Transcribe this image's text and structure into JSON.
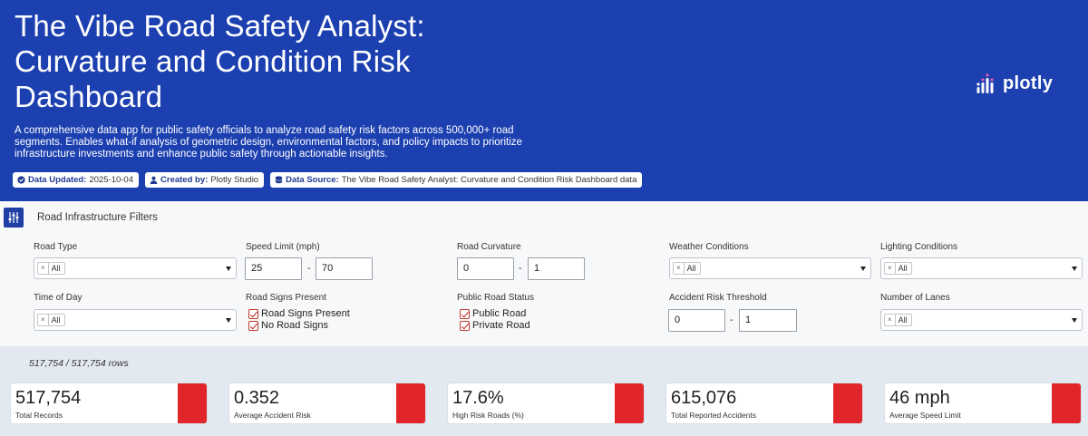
{
  "header": {
    "title": "The Vibe Road Safety Analyst: Curvature and Condition Risk Dashboard",
    "description": "A comprehensive data app for public safety officials to analyze road safety risk factors across 500,000+ road segments. Enables what-if analysis of geometric design, environmental factors, and policy impacts to prioritize infrastructure investments and enhance public safety through actionable insights.",
    "badges": [
      {
        "label": "Data Updated:",
        "value": "2025-10-04",
        "icon": "check-circle-icon"
      },
      {
        "label": "Created by:",
        "value": "Plotly Studio",
        "icon": "user-icon"
      },
      {
        "label": "Data Source:",
        "value": "The Vibe Road Safety Analyst: Curvature and Condition Risk Dashboard data",
        "icon": "database-icon"
      }
    ],
    "logo_text": "plotly"
  },
  "filters": {
    "heading": "Road Infrastructure Filters",
    "road_type": {
      "label": "Road Type",
      "value": "All"
    },
    "speed_limit": {
      "label": "Speed Limit (mph)",
      "min": "25",
      "max": "70"
    },
    "road_curvature": {
      "label": "Road Curvature",
      "min": "0",
      "max": "1"
    },
    "weather": {
      "label": "Weather Conditions",
      "value": "All"
    },
    "lighting": {
      "label": "Lighting Conditions",
      "value": "All"
    },
    "time_of_day": {
      "label": "Time of Day",
      "value": "All"
    },
    "road_signs": {
      "label": "Road Signs Present",
      "options": [
        "Road Signs Present",
        "No Road Signs"
      ]
    },
    "public_road": {
      "label": "Public Road Status",
      "options": [
        "Public Road",
        "Private Road"
      ]
    },
    "risk_threshold": {
      "label": "Accident Risk Threshold",
      "min": "0",
      "max": "1"
    },
    "lanes": {
      "label": "Number of Lanes",
      "value": "All"
    },
    "chip_remove": "×",
    "range_sep": "-"
  },
  "row_count": "517,754 / 517,754 rows",
  "kpis": [
    {
      "value": "517,754",
      "label": "Total Records"
    },
    {
      "value": "0.352",
      "label": "Average Accident Risk"
    },
    {
      "value": "17.6%",
      "label": "High Risk Roads (%)"
    },
    {
      "value": "615,076",
      "label": "Total Reported Accidents"
    },
    {
      "value": "46 mph",
      "label": "Average Speed Limit"
    }
  ],
  "colors": {
    "header_bg": "#1c40b0",
    "accent_red": "#e0262b"
  }
}
